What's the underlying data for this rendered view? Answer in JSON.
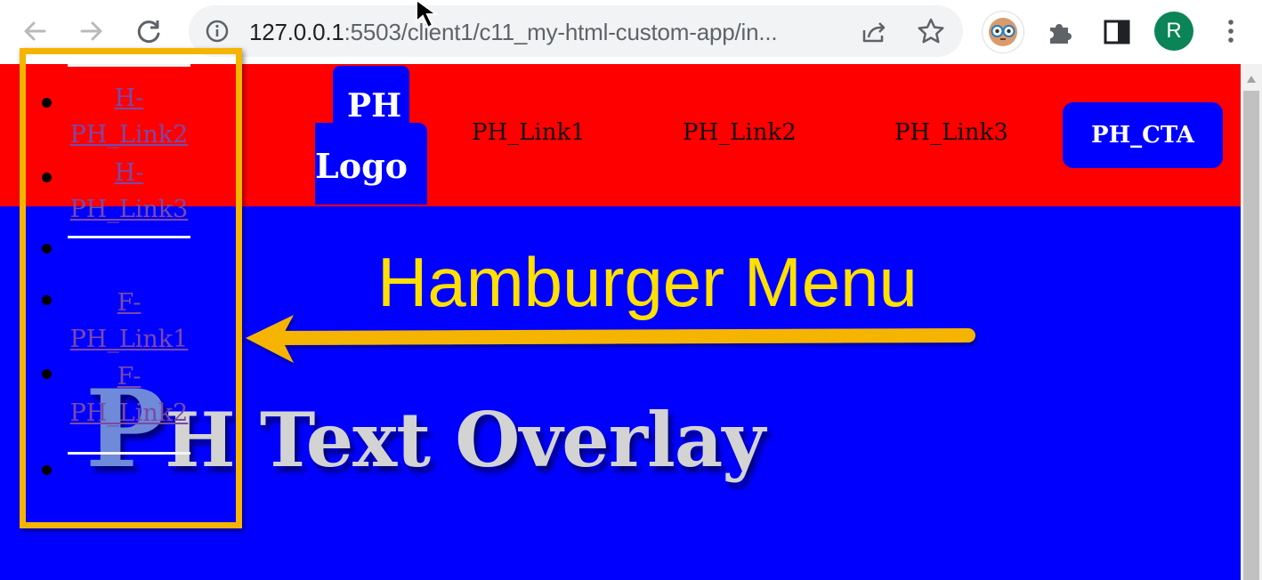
{
  "browser": {
    "url_host": "127.0.0.1",
    "url_rest": ":5503/client1/c11_my-html-custom-app/in...",
    "profile_initial": "R",
    "icons": [
      "back-arrow-icon",
      "forward-arrow-icon",
      "reload-icon",
      "info-icon",
      "share-icon",
      "star-icon",
      "extension-owl-icon",
      "puzzle-icon",
      "side-panel-icon",
      "kebab-menu-icon"
    ],
    "colors": {
      "profile": "#0b8457",
      "omnibox": "#f1f3f4"
    }
  },
  "page": {
    "logo": {
      "line1": "PH",
      "line2": "Logo"
    },
    "nav_links": [
      "PH_Link1",
      "PH_Link2",
      "PH_Link3"
    ],
    "cta": "PH_CTA",
    "overlay_big_letter": "P",
    "overlay_text": "H Text Overlay",
    "colors": {
      "header": "#ff0000",
      "body": "#0000ff",
      "overlay_text": "#d3d3d3"
    }
  },
  "hamburger_menu": {
    "items": [
      {
        "type": "link",
        "line1": "H-",
        "line2": "PH_Link2"
      },
      {
        "type": "link",
        "line1": "H-",
        "line2": "PH_Link3"
      },
      {
        "type": "empty"
      },
      {
        "type": "link",
        "line1": "F-",
        "line2": "PH_Link1"
      },
      {
        "type": "link",
        "line1": "F-",
        "line2": "PH_Link2"
      },
      {
        "type": "empty"
      }
    ]
  },
  "annotation": {
    "label": "Hamburger Menu",
    "color": "#f5b400",
    "text_color": "#ffe000"
  }
}
